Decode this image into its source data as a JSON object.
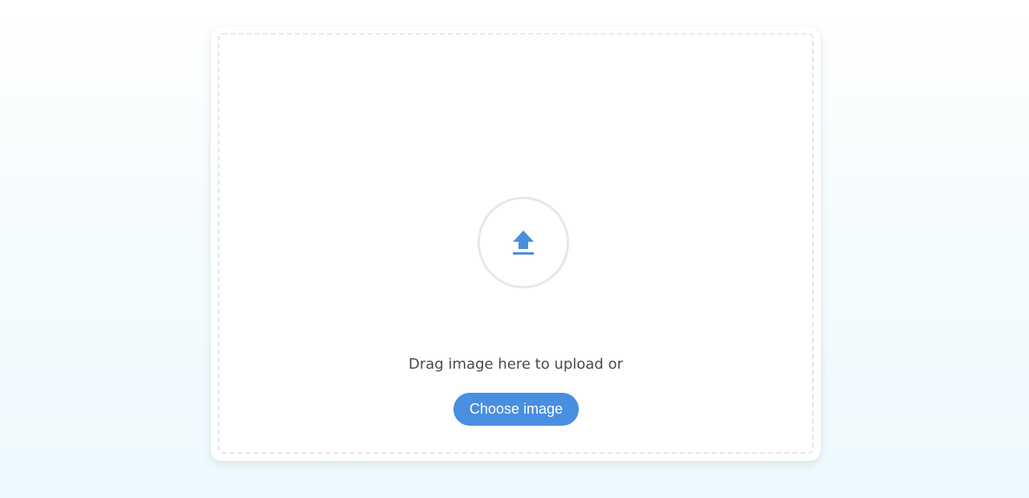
{
  "upload": {
    "icon": "upload-arrow-icon",
    "instruction_text": "Drag image here to upload or",
    "choose_button_label": "Choose image",
    "accent_color": "#4a8ee0"
  }
}
